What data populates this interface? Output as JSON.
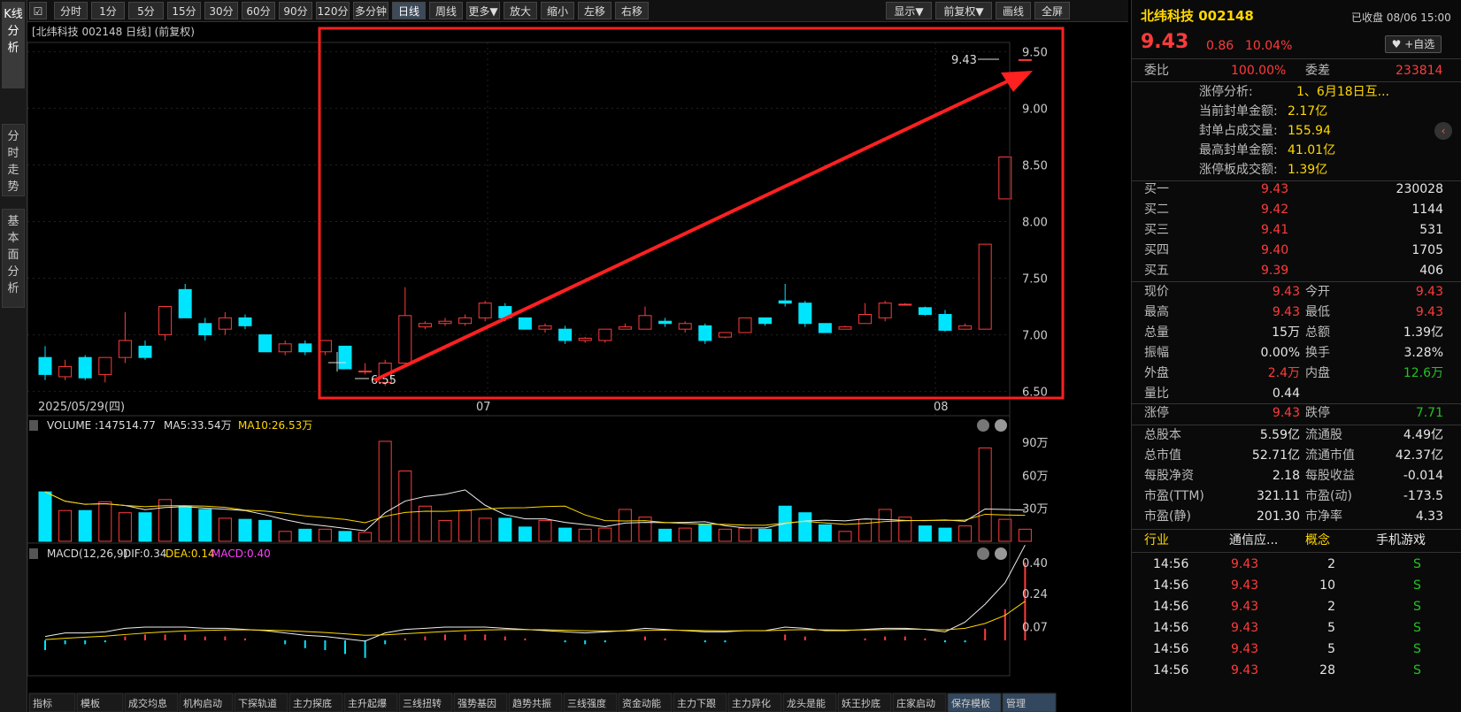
{
  "vtabs": {
    "kline": "K线分析",
    "fenshi": "分时走势",
    "jiben": "基本面分析"
  },
  "toolbar": {
    "periods": [
      "分时",
      "1分",
      "5分",
      "15分",
      "30分",
      "60分",
      "90分",
      "120分",
      "多分钟",
      "日线",
      "周线",
      "更多▼",
      "放大",
      "缩小",
      "左移",
      "右移"
    ],
    "active": "日线",
    "right": [
      "显示▼",
      "前复权▼",
      "画线",
      "全屏"
    ]
  },
  "chart_header": {
    "title": "[北纬科技 002148 日线]  (前复权)"
  },
  "price_axis": {
    "ticks": [
      "9.50",
      "9.00",
      "8.50",
      "8.00",
      "7.50",
      "7.00",
      "6.50"
    ]
  },
  "date_axis": {
    "start": "2025/05/29(四)",
    "mid": "07",
    "end": "08"
  },
  "annotations": {
    "high": "9.43",
    "low": "6.55"
  },
  "volume_panel": {
    "title": "VOLUME",
    "value": ":147514.77",
    "ma5": "MA5:33.54万",
    "ma10": "MA10:26.53万",
    "ticks": [
      "90万",
      "60万",
      "30万"
    ]
  },
  "macd_panel": {
    "title": "MACD(12,26,9)",
    "dif": "DIF:0.34",
    "dea": "DEA:0.14",
    "macd": "MACD:0.40",
    "ticks": [
      "0.40",
      "0.24",
      "0.07"
    ]
  },
  "bottom_tabs": [
    "指标",
    "模板",
    "成交均息",
    "机构启动",
    "下探轨道",
    "主力探底",
    "主升起爆",
    "三线扭转",
    "强势基因",
    "趋势共振",
    "三线强度",
    "资金动能",
    "主力下跟",
    "主力异化",
    "龙头是能",
    "妖王抄底",
    "庄家启动",
    "保存模板",
    "管理"
  ],
  "quote": {
    "name": "北纬科技 002148",
    "status": "已收盘 08/06 15:00",
    "price": "9.43",
    "change": "0.86",
    "pct": "10.04%",
    "watch": "+自选",
    "weibi_label": "委比",
    "weibi": "100.00%",
    "weicha_label": "委差",
    "weicha": "233814",
    "limit_info": [
      {
        "label": "涨停分析:",
        "value": "1、6月18日互..."
      },
      {
        "label": "当前封单金额:",
        "value": "2.17亿"
      },
      {
        "label": "封单占成交量:",
        "value": "155.94"
      },
      {
        "label": "最高封单金额:",
        "value": "41.01亿"
      },
      {
        "label": "涨停板成交额:",
        "value": "1.39亿"
      }
    ],
    "bids": [
      {
        "label": "买一",
        "price": "9.43",
        "vol": "230028"
      },
      {
        "label": "买二",
        "price": "9.42",
        "vol": "1144"
      },
      {
        "label": "买三",
        "price": "9.41",
        "vol": "531"
      },
      {
        "label": "买四",
        "price": "9.40",
        "vol": "1705"
      },
      {
        "label": "买五",
        "price": "9.39",
        "vol": "406"
      }
    ],
    "stats": [
      {
        "l1": "现价",
        "v1": "9.43",
        "l2": "今开",
        "v2": "9.43",
        "c1": "red",
        "c2": "red"
      },
      {
        "l1": "最高",
        "v1": "9.43",
        "l2": "最低",
        "v2": "9.43",
        "c1": "red",
        "c2": "red"
      },
      {
        "l1": "总量",
        "v1": "15万",
        "l2": "总额",
        "v2": "1.39亿",
        "c1": "wht",
        "c2": "wht"
      },
      {
        "l1": "振幅",
        "v1": "0.00%",
        "l2": "换手",
        "v2": "3.28%",
        "c1": "wht",
        "c2": "wht"
      },
      {
        "l1": "外盘",
        "v1": "2.4万",
        "l2": "内盘",
        "v2": "12.6万",
        "c1": "red",
        "c2": "green"
      },
      {
        "l1": "量比",
        "v1": "0.44",
        "l2": "",
        "v2": "",
        "c1": "wht",
        "c2": "wht"
      }
    ],
    "limits": {
      "up_label": "涨停",
      "up": "9.43",
      "down_label": "跌停",
      "down": "7.71"
    },
    "fund": [
      {
        "l1": "总股本",
        "v1": "5.59亿",
        "l2": "流通股",
        "v2": "4.49亿"
      },
      {
        "l1": "总市值",
        "v1": "52.71亿",
        "l2": "流通市值",
        "v2": "42.37亿"
      },
      {
        "l1": "每股净资",
        "v1": "2.18",
        "l2": "每股收益",
        "v2": "-0.014"
      },
      {
        "l1": "市盈(TTM)",
        "v1": "321.11",
        "l2": "市盈(动)",
        "v2": "-173.5"
      },
      {
        "l1": "市盈(静)",
        "v1": "201.30",
        "l2": "市净率",
        "v2": "4.33"
      }
    ],
    "industry": {
      "label": "行业",
      "value": "通信应...",
      "concept_label": "概念",
      "concept": "手机游戏"
    },
    "ticks": [
      {
        "time": "14:56",
        "price": "9.43",
        "vol": "2",
        "side": "S"
      },
      {
        "time": "14:56",
        "price": "9.43",
        "vol": "10",
        "side": "S"
      },
      {
        "time": "14:56",
        "price": "9.43",
        "vol": "2",
        "side": "S"
      },
      {
        "time": "14:56",
        "price": "9.43",
        "vol": "5",
        "side": "S"
      },
      {
        "time": "14:56",
        "price": "9.43",
        "vol": "5",
        "side": "S"
      },
      {
        "time": "14:56",
        "price": "9.43",
        "vol": "28",
        "side": "S"
      }
    ]
  },
  "chart_data": {
    "type": "candlestick",
    "ylim": [
      6.45,
      9.55
    ],
    "candles": [
      [
        6.8,
        6.65,
        6.9,
        6.6
      ],
      [
        6.63,
        6.72,
        6.78,
        6.6
      ],
      [
        6.8,
        6.62,
        6.82,
        6.6
      ],
      [
        6.65,
        6.8,
        6.8,
        6.58
      ],
      [
        6.8,
        6.95,
        7.2,
        6.75
      ],
      [
        6.9,
        6.8,
        6.95,
        6.78
      ],
      [
        7.0,
        7.25,
        7.25,
        6.95
      ],
      [
        7.4,
        7.15,
        7.45,
        7.15
      ],
      [
        7.1,
        7.0,
        7.15,
        6.95
      ],
      [
        7.05,
        7.15,
        7.2,
        7.0
      ],
      [
        7.15,
        7.08,
        7.18,
        7.05
      ],
      [
        7.0,
        6.85,
        7.0,
        6.85
      ],
      [
        6.85,
        6.92,
        6.95,
        6.82
      ],
      [
        6.92,
        6.85,
        6.95,
        6.82
      ],
      [
        6.85,
        6.95,
        6.95,
        6.82
      ],
      [
        6.9,
        6.7,
        6.9,
        6.7
      ],
      [
        6.68,
        6.68,
        6.75,
        6.65
      ],
      [
        6.58,
        6.75,
        6.78,
        6.55
      ],
      [
        6.75,
        7.17,
        7.42,
        6.75
      ],
      [
        7.07,
        7.1,
        7.12,
        7.05
      ],
      [
        7.1,
        7.12,
        7.15,
        7.08
      ],
      [
        7.1,
        7.15,
        7.18,
        7.08
      ],
      [
        7.15,
        7.28,
        7.3,
        7.12
      ],
      [
        7.25,
        7.15,
        7.28,
        7.12
      ],
      [
        7.15,
        7.05,
        7.15,
        7.05
      ],
      [
        7.05,
        7.08,
        7.1,
        7.02
      ],
      [
        7.05,
        6.95,
        7.08,
        6.92
      ],
      [
        6.95,
        6.97,
        6.98,
        6.93
      ],
      [
        6.95,
        7.05,
        7.05,
        6.93
      ],
      [
        7.05,
        7.07,
        7.1,
        7.05
      ],
      [
        7.05,
        7.17,
        7.25,
        7.05
      ],
      [
        7.12,
        7.1,
        7.15,
        7.07
      ],
      [
        7.05,
        7.1,
        7.12,
        7.02
      ],
      [
        7.08,
        6.95,
        7.1,
        6.92
      ],
      [
        6.98,
        7.02,
        7.02,
        6.97
      ],
      [
        7.02,
        7.15,
        7.15,
        7.02
      ],
      [
        7.15,
        7.1,
        7.15,
        7.08
      ],
      [
        7.3,
        7.28,
        7.45,
        7.25
      ],
      [
        7.28,
        7.1,
        7.3,
        7.07
      ],
      [
        7.1,
        7.02,
        7.1,
        7.02
      ],
      [
        7.05,
        7.07,
        7.08,
        7.05
      ],
      [
        7.1,
        7.18,
        7.28,
        7.1
      ],
      [
        7.15,
        7.28,
        7.3,
        7.12
      ],
      [
        7.27,
        7.27,
        7.28,
        7.27
      ],
      [
        7.24,
        7.18,
        7.25,
        7.17
      ],
      [
        7.18,
        7.04,
        7.22,
        7.03
      ],
      [
        7.05,
        7.08,
        7.1,
        7.05
      ],
      [
        7.05,
        7.8,
        7.8,
        7.05
      ],
      [
        8.2,
        8.57,
        8.57,
        8.2
      ],
      [
        9.43,
        9.43,
        9.43,
        9.43
      ]
    ],
    "volume": [
      45,
      28,
      28,
      36,
      26,
      26,
      38,
      32,
      29,
      21,
      20,
      19,
      9,
      11,
      11,
      9,
      8,
      91,
      64,
      32,
      19,
      28,
      21,
      21,
      13,
      19,
      12,
      11,
      12,
      29,
      22,
      11,
      12,
      15,
      11,
      12,
      11,
      32,
      26,
      15,
      9,
      20,
      29,
      22,
      14,
      12,
      14,
      85,
      20,
      11
    ],
    "macd_hist": [
      -0.05,
      -0.02,
      -0.02,
      -0.01,
      0.02,
      0.03,
      0.03,
      0.03,
      0.02,
      0.02,
      0.01,
      0.0,
      -0.02,
      -0.04,
      -0.05,
      -0.07,
      -0.09,
      -0.02,
      0.01,
      0.02,
      0.03,
      0.03,
      0.03,
      0.02,
      0.01,
      0.0,
      -0.01,
      -0.02,
      -0.01,
      0.0,
      0.02,
      0.01,
      0.0,
      -0.01,
      -0.01,
      0.0,
      0.0,
      0.03,
      0.02,
      0.0,
      0.0,
      0.01,
      0.02,
      0.02,
      0.01,
      -0.01,
      -0.01,
      0.06,
      0.16,
      0.4
    ]
  }
}
